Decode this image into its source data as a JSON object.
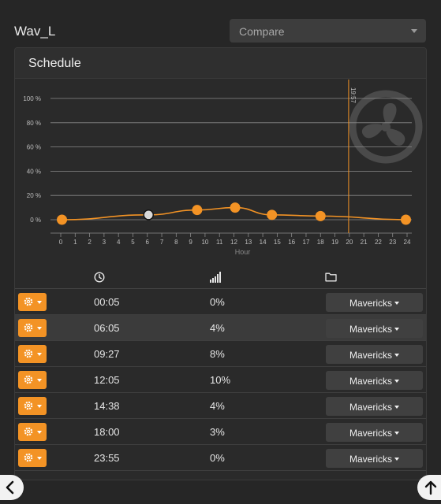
{
  "header": {
    "title": "Wav_L",
    "compare_label": "Compare"
  },
  "card": {
    "title": "Schedule"
  },
  "chart_data": {
    "type": "line",
    "xlabel": "Hour",
    "x_ticks": [
      "0",
      "1",
      "2",
      "3",
      "4",
      "5",
      "6",
      "7",
      "8",
      "9",
      "10",
      "11",
      "12",
      "13",
      "14",
      "15",
      "16",
      "17",
      "18",
      "19",
      "20",
      "21",
      "22",
      "23",
      "24"
    ],
    "y_ticks": [
      "100 %",
      "80 %",
      "60 %",
      "40 %",
      "20 %",
      "0 %"
    ],
    "xlim": [
      0,
      24
    ],
    "ylim": [
      0,
      100
    ],
    "grid": true,
    "points": [
      {
        "x": 0.083,
        "y": 0
      },
      {
        "x": 6.083,
        "y": 4
      },
      {
        "x": 9.45,
        "y": 8
      },
      {
        "x": 12.083,
        "y": 10
      },
      {
        "x": 14.633,
        "y": 4
      },
      {
        "x": 18.0,
        "y": 3
      },
      {
        "x": 23.917,
        "y": 0
      }
    ],
    "selected_index": 1,
    "current_time": {
      "x": 19.95,
      "label": "19:57"
    },
    "colors": {
      "line": "#f39325",
      "point": "#f39325",
      "selected_point": "#d9d9d9",
      "now_line": "#f39325",
      "grid": "#8a8a8a"
    }
  },
  "table": {
    "header_icons": [
      "clock-icon",
      "signal-bars-icon",
      "folder-icon"
    ],
    "rows": [
      {
        "time": "00:05",
        "level": "0%",
        "schedule": "Mavericks"
      },
      {
        "time": "06:05",
        "level": "4%",
        "schedule": "Mavericks"
      },
      {
        "time": "09:27",
        "level": "8%",
        "schedule": "Mavericks"
      },
      {
        "time": "12:05",
        "level": "10%",
        "schedule": "Mavericks"
      },
      {
        "time": "14:38",
        "level": "4%",
        "schedule": "Mavericks"
      },
      {
        "time": "18:00",
        "level": "3%",
        "schedule": "Mavericks"
      },
      {
        "time": "23:55",
        "level": "0%",
        "schedule": "Mavericks"
      }
    ],
    "highlighted_row": 1
  },
  "nav": {
    "left_icon": "chevron-left-icon",
    "right_icon": "arrow-up-icon"
  },
  "colors": {
    "accent": "#f39325",
    "background": "#262626",
    "card": "#2a2a2a"
  }
}
